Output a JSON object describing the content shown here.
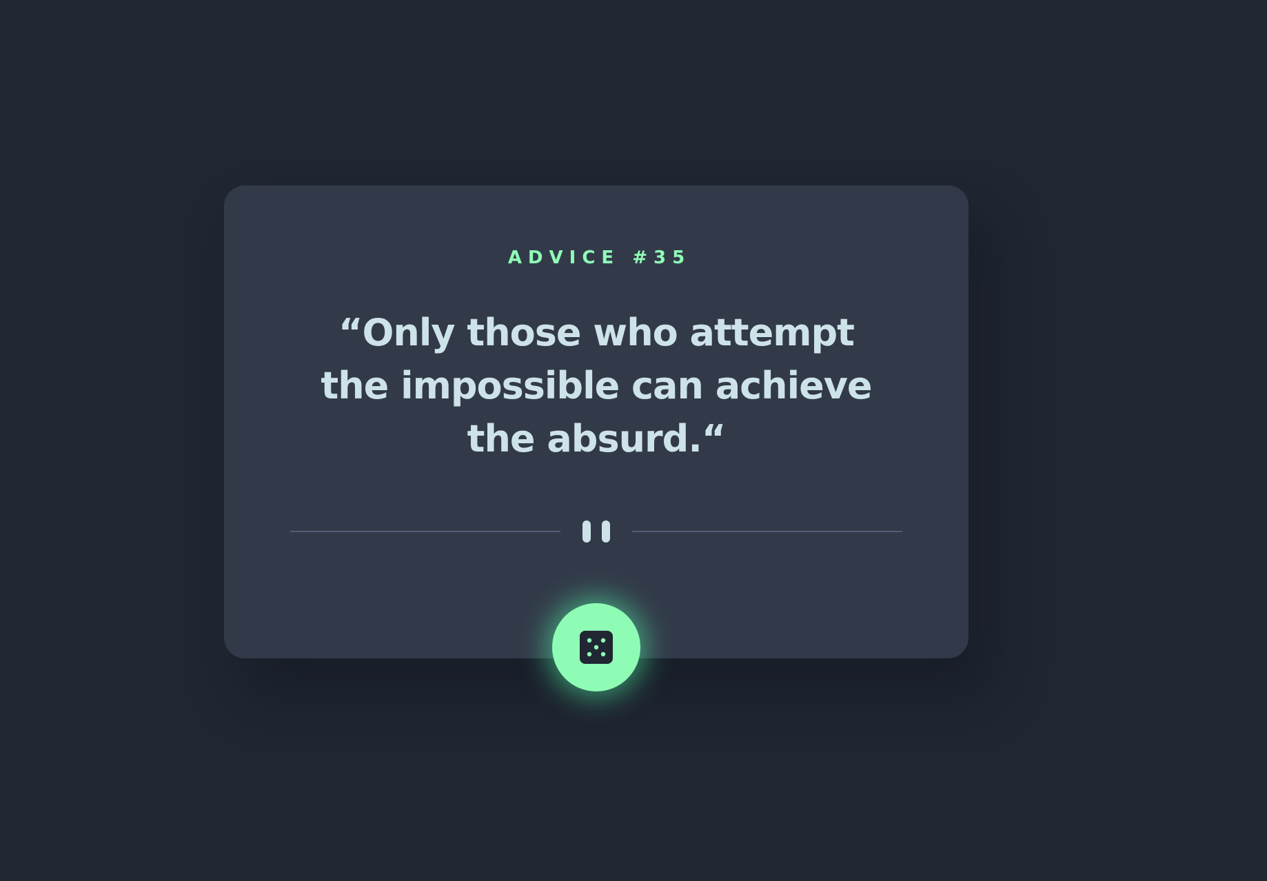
{
  "advice": {
    "label": "ADVICE #35",
    "quote": "“Only those who attempt the impossible can achieve the absurd.“"
  },
  "divider": {
    "icon": "pause-icon"
  },
  "button": {
    "icon": "dice-icon"
  },
  "colors": {
    "background": "#202632",
    "card": "#323a49",
    "accent": "#8ffcb6",
    "text": "#cee3e9",
    "divider": "#4f5d74"
  }
}
